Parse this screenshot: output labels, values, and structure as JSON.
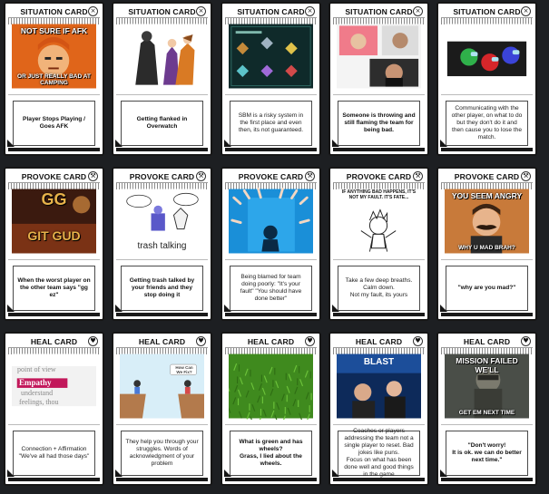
{
  "card_types": {
    "situation": "SITUATION CARD",
    "provoke": "PROVOKE CARD",
    "heal": "HEAL CARD"
  },
  "badges": {
    "situation": "×",
    "provoke": "⚒",
    "heal": "♥"
  },
  "colors": {
    "background": "#1d1f22",
    "card": "#ffffff",
    "border": "#161616"
  },
  "rows": [
    {
      "type": "situation",
      "cards": [
        {
          "art": "not-sure-if-afk-meme",
          "meme_top": "NOT SURE IF AFK",
          "meme_bottom": "OR JUST REALLY BAD AT CAMPING",
          "caption": "Player Stops Playing / Goes AFK",
          "bold": true
        },
        {
          "art": "overwatch-heroes",
          "caption": "Getting flanked in Overwatch",
          "bold": true
        },
        {
          "art": "rank-badges",
          "caption": "SBM is a risky system in the first place and even then, its not guaranteed.",
          "bold": false
        },
        {
          "art": "streamer-reaction",
          "caption": "Someone is throwing and still flaming the team for being bad.",
          "bold": true
        },
        {
          "art": "among-us-crewmates",
          "caption": "Communicating with the other player, on what to do but they don't do it and then cause you to lose the match.",
          "bold": false
        }
      ]
    },
    {
      "type": "provoke",
      "cards": [
        {
          "art": "gg-git-gud-logo",
          "meme_top": "GG",
          "meme_bottom": "GIT GUD",
          "caption": "When the worst player on the other team says \"gg ez\"",
          "bold": true
        },
        {
          "art": "trash-talking-comic",
          "art_text": "trash talking",
          "caption": "Getting trash talked by your friends and they stop doing it",
          "bold": true
        },
        {
          "art": "pointing-fingers",
          "caption": "Being blamed for team doing poorly: \"It's your fault\" \"You should have done better\"",
          "bold": false
        },
        {
          "art": "calvin-comic",
          "meme_top": "IF ANYTHING BAD HAPPENS, IT'S NOT MY FAULT. IT'S FATE...",
          "caption": "Take a few deep breaths.\nCalm down.\nNot my fault, its yours",
          "bold": false
        },
        {
          "art": "why-u-mad-bro-meme",
          "meme_top": "YOU SEEM ANGRY",
          "meme_bottom": "WHY U MAD BRAH?",
          "caption": "\"why are you mad?\"",
          "bold": true
        }
      ]
    },
    {
      "type": "heal",
      "cards": [
        {
          "art": "empathy-words",
          "art_words": [
            "point of view",
            "Empathy",
            "understand",
            "feelings, thou"
          ],
          "caption": "Connection + Affirmation\n\"We've all had those days\"",
          "bold": false
        },
        {
          "art": "bridge-illustration",
          "art_text": "How Can We Fix?",
          "caption": "They help you through your struggles. Words of acknowledgment of your problem",
          "bold": false
        },
        {
          "art": "grass-photo",
          "caption": "What is green and has wheels?\nGrass, I lied about the wheels.",
          "bold": true
        },
        {
          "art": "esports-coach",
          "art_text": "BLAST",
          "caption": "Coaches or players addressing the team not a single player to reset. Bad jokes like puns.\nFocus on what has been done well and good things in the game",
          "bold": false
        },
        {
          "art": "mission-failed-meme",
          "meme_top": "MISSION FAILED WE'LL",
          "meme_bottom": "GET EM NEXT TIME",
          "caption": "\"Don't worry!\nIt is ok. we can do better next time.\"",
          "bold": true
        }
      ]
    }
  ]
}
